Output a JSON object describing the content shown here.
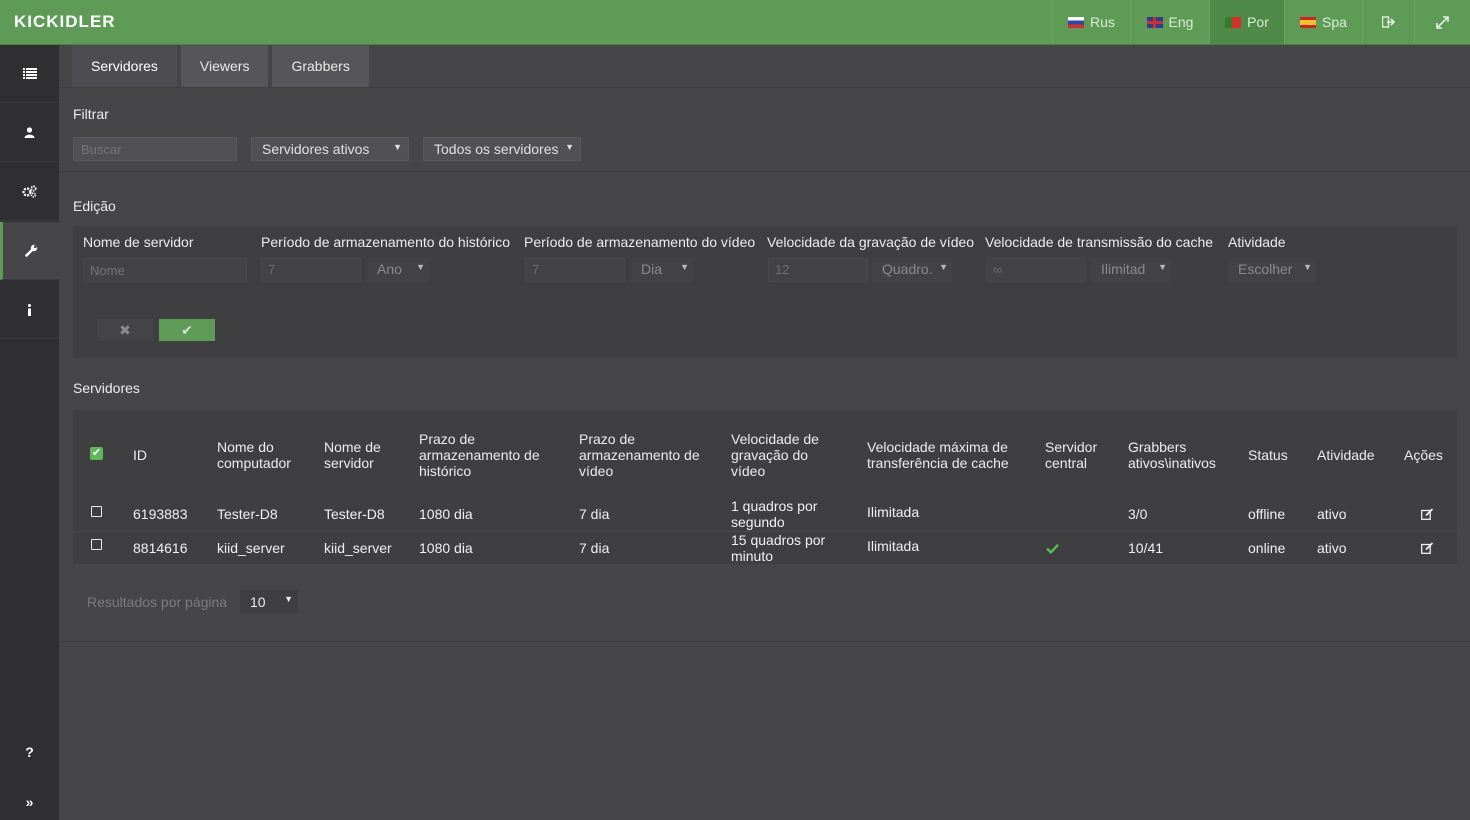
{
  "header": {
    "logo": "KICKIDLER",
    "languages": [
      {
        "label": "Rus",
        "flag": "flag-ru"
      },
      {
        "label": "Eng",
        "flag": "flag-en"
      },
      {
        "label": "Por",
        "flag": "flag-pt"
      },
      {
        "label": "Spa",
        "flag": "flag-es"
      }
    ],
    "active_language": "Por",
    "icons": [
      "logout-icon",
      "fullscreen-icon"
    ]
  },
  "sidebar": {
    "items": [
      "list-icon",
      "user-icon",
      "settings-gears-icon",
      "wrench-icon",
      "info-icon"
    ],
    "active": "wrench-icon",
    "help": "?",
    "expand": "»"
  },
  "tabs": [
    {
      "label": "Servidores",
      "active": true
    },
    {
      "label": "Viewers",
      "active": false
    },
    {
      "label": "Grabbers",
      "active": false
    }
  ],
  "filter": {
    "title": "Filtrar",
    "search_placeholder": "Buscar",
    "status_select": "Servidores ativos",
    "scope_select": "Todos os servidores"
  },
  "edit": {
    "title": "Edição",
    "labels": {
      "server_name": "Nome de servidor",
      "history_period": "Período de armazenamento do histórico",
      "video_period": "Período de armazenamento do vídeo",
      "video_speed": "Velocidade da gravação de vídeo",
      "cache_speed": "Velocidade de transmissão do cache",
      "activity": "Atividade"
    },
    "fields": {
      "server_name_placeholder": "Nome",
      "history_value": "7",
      "history_unit": "Ano",
      "video_value": "7",
      "video_unit": "Dia",
      "speed_value": "12",
      "speed_unit": "Quadro.",
      "cache_value": "∞",
      "cache_unit": "Ilimitad",
      "activity_select": "Escolher"
    },
    "cancel_symbol": "✖",
    "ok_symbol": "✔"
  },
  "servers": {
    "title": "Servidores",
    "columns": [
      "ID",
      "Nome do computador",
      "Nome de servidor",
      "Prazo de armazenamento de histórico",
      "Prazo de armazenamento de vídeo",
      "Velocidade de gravação do vídeo",
      "Velocidade máxima de transferência de cache",
      "Servidor central",
      "Grabbers ativos\\inativos",
      "Status",
      "Atividade",
      "Ações"
    ],
    "rows": [
      {
        "id": "6193883",
        "computer": "Tester-D8",
        "server": "Tester-D8",
        "history": "1080 dia",
        "video": "7 dia",
        "speed": "1 quadros por segundo",
        "cache": "Ilimitada",
        "central": false,
        "grabbers": "3/0",
        "status": "offline",
        "activity": "ativo"
      },
      {
        "id": "8814616",
        "computer": "kiid_server",
        "server": "kiid_server",
        "history": "1080 dia",
        "video": "7 dia",
        "speed": "15 quadros por minuto",
        "cache": "Ilimitada",
        "central": true,
        "grabbers": "10/41",
        "status": "online",
        "activity": "ativo"
      }
    ],
    "results_label": "Resultados por página",
    "results_value": "10"
  },
  "colors": {
    "accent": "#5e9b57",
    "topbar": "#5e9b57",
    "sidebar": "#2f2f31",
    "background": "#464649",
    "check_green": "#5fb857"
  }
}
